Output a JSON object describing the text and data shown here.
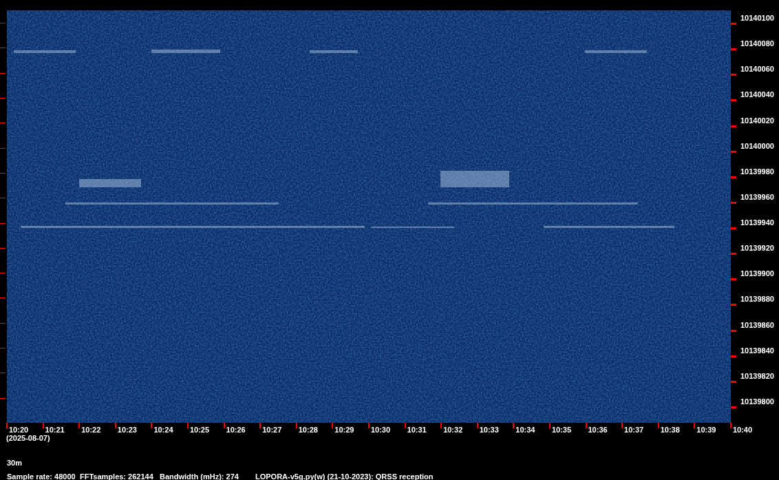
{
  "spectrogram": {
    "frequency_labels": [
      "10140100",
      "10140080",
      "10140060",
      "10140040",
      "10140020",
      "10140000",
      "10139980",
      "10139960",
      "10139940",
      "10139920",
      "10139900",
      "10139880",
      "10139860",
      "10139840",
      "10139820",
      "10139800"
    ],
    "time_labels": [
      "10:20",
      "10:21",
      "10:22",
      "10:23",
      "10:24",
      "10:25",
      "10:26",
      "10:27",
      "10:28",
      "10:29",
      "10:30",
      "10:31",
      "10:32",
      "10:33",
      "10:34",
      "10:35",
      "10:36",
      "10:37",
      "10:38",
      "10:39",
      "10:40"
    ],
    "date": "(2025-08-07)"
  },
  "band": "30m",
  "info": [
    "Sample rate: 48000",
    "FFTsamples: 262144",
    "Bandwidth (mHz): 274",
    "LOPORA-v5g.py(w) (21-10-2023): QRSS reception"
  ]
}
